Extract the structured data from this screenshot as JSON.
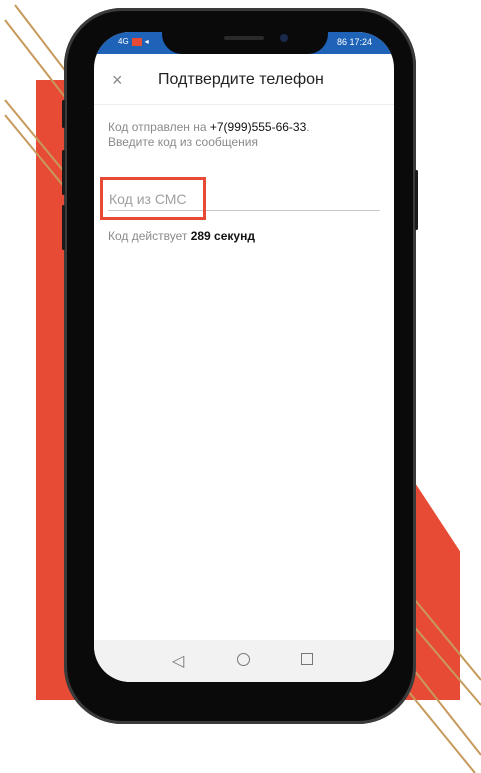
{
  "status_bar": {
    "left_indicators": "4G",
    "time": "17:24",
    "battery": "86"
  },
  "header": {
    "close_icon": "×",
    "title": "Подтвердите телефон"
  },
  "info": {
    "sent_prefix": "Код отправлен на",
    "phone": "+7(999)555-66-33",
    "sent_suffix": ".",
    "instruction": "Введите код из сообщения"
  },
  "code_input": {
    "placeholder": "Код из СМС",
    "value": ""
  },
  "timer": {
    "prefix": "Код действует",
    "value": "289 секунд"
  },
  "navbar": {
    "back": "◁",
    "home": "home",
    "recent": "recent"
  },
  "colors": {
    "accent_red": "#e84b35",
    "status_blue": "#1e63b8",
    "gold_line": "#c79a5c"
  }
}
